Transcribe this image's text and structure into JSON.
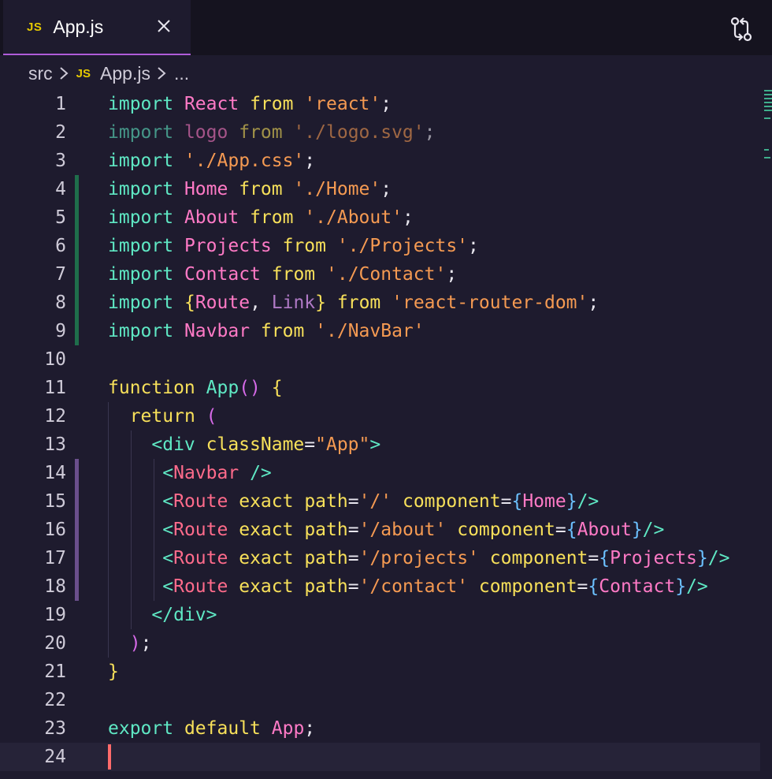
{
  "tab": {
    "icon_text": "JS",
    "label": "App.js"
  },
  "breadcrumb": {
    "folder": "src",
    "icon_text": "JS",
    "file": "App.js",
    "more": "..."
  },
  "icons": {
    "close": "close-icon",
    "compare": "compare-changes-icon",
    "chevron": "chevron-right-icon"
  },
  "colors": {
    "accent": "#b05cd9",
    "background": "#1e1b2e",
    "added": "#1f6e4b",
    "modified": "#6b4f8c",
    "cursor": "#ff6b6b"
  },
  "editor": {
    "current_line": 24,
    "lines": [
      {
        "n": "1",
        "tokens": [
          [
            "kw",
            "import"
          ],
          [
            "punc",
            " "
          ],
          [
            "id",
            "React"
          ],
          [
            "punc",
            " "
          ],
          [
            "fn",
            "from"
          ],
          [
            "punc",
            " "
          ],
          [
            "str",
            "'react'"
          ],
          [
            "punc",
            ";"
          ]
        ]
      },
      {
        "n": "2",
        "tokens": [
          [
            "kw dim",
            "import"
          ],
          [
            "punc",
            " "
          ],
          [
            "id dim",
            "logo"
          ],
          [
            "punc",
            " "
          ],
          [
            "fn dim",
            "from"
          ],
          [
            "punc",
            " "
          ],
          [
            "str dim",
            "'./logo.svg'"
          ],
          [
            "punc dim",
            ";"
          ]
        ]
      },
      {
        "n": "3",
        "tokens": [
          [
            "kw",
            "import"
          ],
          [
            "punc",
            " "
          ],
          [
            "str",
            "'./App.css'"
          ],
          [
            "punc",
            ";"
          ]
        ]
      },
      {
        "n": "4",
        "tokens": [
          [
            "kw",
            "import"
          ],
          [
            "punc",
            " "
          ],
          [
            "id",
            "Home"
          ],
          [
            "punc",
            " "
          ],
          [
            "fn",
            "from"
          ],
          [
            "punc",
            " "
          ],
          [
            "str",
            "'./Home'"
          ],
          [
            "punc",
            ";"
          ]
        ]
      },
      {
        "n": "5",
        "tokens": [
          [
            "kw",
            "import"
          ],
          [
            "punc",
            " "
          ],
          [
            "id",
            "About"
          ],
          [
            "punc",
            " "
          ],
          [
            "fn",
            "from"
          ],
          [
            "punc",
            " "
          ],
          [
            "str",
            "'./About'"
          ],
          [
            "punc",
            ";"
          ]
        ]
      },
      {
        "n": "6",
        "tokens": [
          [
            "kw",
            "import"
          ],
          [
            "punc",
            " "
          ],
          [
            "id",
            "Projects"
          ],
          [
            "punc",
            " "
          ],
          [
            "fn",
            "from"
          ],
          [
            "punc",
            " "
          ],
          [
            "str",
            "'./Projects'"
          ],
          [
            "punc",
            ";"
          ]
        ]
      },
      {
        "n": "7",
        "tokens": [
          [
            "kw",
            "import"
          ],
          [
            "punc",
            " "
          ],
          [
            "id",
            "Contact"
          ],
          [
            "punc",
            " "
          ],
          [
            "fn",
            "from"
          ],
          [
            "punc",
            " "
          ],
          [
            "str",
            "'./Contact'"
          ],
          [
            "punc",
            ";"
          ]
        ]
      },
      {
        "n": "8",
        "tokens": [
          [
            "kw",
            "import"
          ],
          [
            "punc",
            " "
          ],
          [
            "brace1",
            "{"
          ],
          [
            "id",
            "Route"
          ],
          [
            "punc",
            ", "
          ],
          [
            "dimlink",
            "Link"
          ],
          [
            "brace1",
            "}"
          ],
          [
            "punc",
            " "
          ],
          [
            "fn",
            "from"
          ],
          [
            "punc",
            " "
          ],
          [
            "str",
            "'react-router-dom'"
          ],
          [
            "punc",
            ";"
          ]
        ]
      },
      {
        "n": "9",
        "tokens": [
          [
            "kw",
            "import"
          ],
          [
            "punc",
            " "
          ],
          [
            "id",
            "Navbar"
          ],
          [
            "punc",
            " "
          ],
          [
            "fn",
            "from"
          ],
          [
            "punc",
            " "
          ],
          [
            "str",
            "'./NavBar'"
          ]
        ]
      },
      {
        "n": "10",
        "tokens": []
      },
      {
        "n": "11",
        "tokens": [
          [
            "fn",
            "function"
          ],
          [
            "punc",
            " "
          ],
          [
            "kw",
            "App"
          ],
          [
            "brace2",
            "()"
          ],
          [
            "punc",
            " "
          ],
          [
            "brace1",
            "{"
          ]
        ]
      },
      {
        "n": "12",
        "tokens": [
          [
            "punc",
            "  "
          ],
          [
            "fn",
            "return"
          ],
          [
            "punc",
            " "
          ],
          [
            "brace2",
            "("
          ]
        ]
      },
      {
        "n": "13",
        "tokens": [
          [
            "punc",
            "    "
          ],
          [
            "tag",
            "<div"
          ],
          [
            "punc",
            " "
          ],
          [
            "attr",
            "className"
          ],
          [
            "punc",
            "="
          ],
          [
            "str",
            "\"App\""
          ],
          [
            "tag",
            ">"
          ]
        ]
      },
      {
        "n": "14",
        "tokens": [
          [
            "punc",
            "     "
          ],
          [
            "tag",
            "<"
          ],
          [
            "comp",
            "Navbar"
          ],
          [
            "punc",
            " "
          ],
          [
            "tag",
            "/>"
          ]
        ]
      },
      {
        "n": "15",
        "tokens": [
          [
            "punc",
            "     "
          ],
          [
            "tag",
            "<"
          ],
          [
            "comp",
            "Route"
          ],
          [
            "punc",
            " "
          ],
          [
            "attr",
            "exact"
          ],
          [
            "punc",
            " "
          ],
          [
            "attr",
            "path"
          ],
          [
            "punc",
            "="
          ],
          [
            "str",
            "'/'"
          ],
          [
            "punc",
            " "
          ],
          [
            "attr",
            "component"
          ],
          [
            "punc",
            "="
          ],
          [
            "brace3",
            "{"
          ],
          [
            "id",
            "Home"
          ],
          [
            "brace3",
            "}"
          ],
          [
            "tag",
            "/>"
          ]
        ]
      },
      {
        "n": "16",
        "tokens": [
          [
            "punc",
            "     "
          ],
          [
            "tag",
            "<"
          ],
          [
            "comp",
            "Route"
          ],
          [
            "punc",
            " "
          ],
          [
            "attr",
            "exact"
          ],
          [
            "punc",
            " "
          ],
          [
            "attr",
            "path"
          ],
          [
            "punc",
            "="
          ],
          [
            "str",
            "'/about'"
          ],
          [
            "punc",
            " "
          ],
          [
            "attr",
            "component"
          ],
          [
            "punc",
            "="
          ],
          [
            "brace3",
            "{"
          ],
          [
            "id",
            "About"
          ],
          [
            "brace3",
            "}"
          ],
          [
            "tag",
            "/>"
          ]
        ]
      },
      {
        "n": "17",
        "tokens": [
          [
            "punc",
            "     "
          ],
          [
            "tag",
            "<"
          ],
          [
            "comp",
            "Route"
          ],
          [
            "punc",
            " "
          ],
          [
            "attr",
            "exact"
          ],
          [
            "punc",
            " "
          ],
          [
            "attr",
            "path"
          ],
          [
            "punc",
            "="
          ],
          [
            "str",
            "'/projects'"
          ],
          [
            "punc",
            " "
          ],
          [
            "attr",
            "component"
          ],
          [
            "punc",
            "="
          ],
          [
            "brace3",
            "{"
          ],
          [
            "id",
            "Projects"
          ],
          [
            "brace3",
            "}"
          ],
          [
            "tag",
            "/>"
          ]
        ]
      },
      {
        "n": "18",
        "tokens": [
          [
            "punc",
            "     "
          ],
          [
            "tag",
            "<"
          ],
          [
            "comp",
            "Route"
          ],
          [
            "punc",
            " "
          ],
          [
            "attr",
            "exact"
          ],
          [
            "punc",
            " "
          ],
          [
            "attr",
            "path"
          ],
          [
            "punc",
            "="
          ],
          [
            "str",
            "'/contact'"
          ],
          [
            "punc",
            " "
          ],
          [
            "attr",
            "component"
          ],
          [
            "punc",
            "="
          ],
          [
            "brace3",
            "{"
          ],
          [
            "id",
            "Contact"
          ],
          [
            "brace3",
            "}"
          ],
          [
            "tag",
            "/>"
          ]
        ]
      },
      {
        "n": "19",
        "tokens": [
          [
            "punc",
            "    "
          ],
          [
            "tag",
            "</div>"
          ]
        ]
      },
      {
        "n": "20",
        "tokens": [
          [
            "punc",
            "  "
          ],
          [
            "brace2",
            ")"
          ],
          [
            "punc",
            ";"
          ]
        ]
      },
      {
        "n": "21",
        "tokens": [
          [
            "brace1",
            "}"
          ]
        ]
      },
      {
        "n": "22",
        "tokens": []
      },
      {
        "n": "23",
        "tokens": [
          [
            "kw",
            "export"
          ],
          [
            "punc",
            " "
          ],
          [
            "fn",
            "default"
          ],
          [
            "punc",
            " "
          ],
          [
            "id",
            "App"
          ],
          [
            "punc",
            ";"
          ]
        ]
      },
      {
        "n": "24",
        "tokens": []
      }
    ]
  }
}
